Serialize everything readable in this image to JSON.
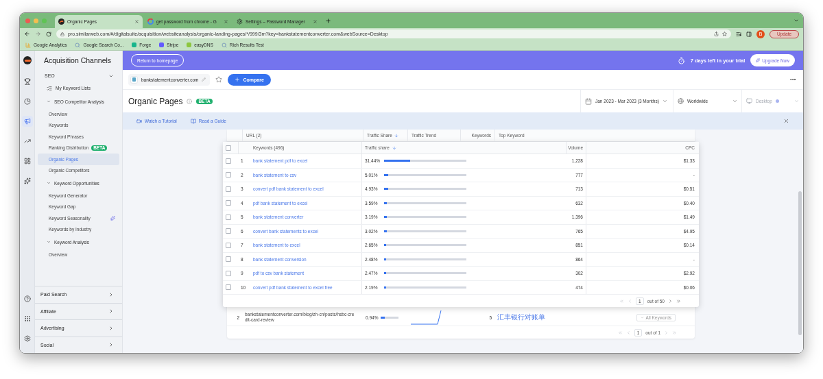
{
  "browser": {
    "tabs": [
      {
        "title": "Organic Pages",
        "selected": true,
        "kind": "site"
      },
      {
        "title": "get password from chrome - G",
        "selected": false,
        "kind": "google"
      },
      {
        "title": "Settings – Password Manager",
        "selected": false,
        "kind": "gear"
      }
    ],
    "url": "pro.similarweb.com/#/digitalsuite/acquisition/websiteanalysis/organic-landing-pages/*/999/3m?key=bankstatementconverter.com&webSource=Desktop",
    "profile": "B",
    "update_button": "Update",
    "bookmarks": [
      {
        "label": "Google Analytics",
        "kind": "analytics"
      },
      {
        "label": "Google Search Co...",
        "kind": "search"
      },
      {
        "label": "Forge",
        "kind": "forge"
      },
      {
        "label": "Stripe",
        "kind": "stripe"
      },
      {
        "label": "easyDNS",
        "kind": "easydns"
      },
      {
        "label": "Rich Results Test",
        "kind": "search"
      }
    ]
  },
  "rail": [
    {
      "kind": "trophy",
      "selected": false
    },
    {
      "kind": "pie",
      "selected": false
    },
    {
      "kind": "megaphone",
      "selected": true
    },
    {
      "kind": "trend",
      "selected": false
    },
    {
      "kind": "dashboard",
      "selected": false
    },
    {
      "kind": "sparkle",
      "selected": false
    }
  ],
  "rail_bottom": [
    {
      "kind": "help"
    },
    {
      "kind": "apps"
    },
    {
      "kind": "settings"
    }
  ],
  "sidebar": {
    "title": "Acquisition Channels",
    "section": {
      "label": "SEO",
      "expanded": true
    },
    "items": [
      {
        "label": "My Keyword Lists",
        "kind": "link"
      },
      {
        "label": "SEO Competitor Analysis",
        "kind": "group",
        "expanded": true,
        "children": [
          {
            "label": "Overview",
            "selected": false
          },
          {
            "label": "Keywords",
            "selected": false
          },
          {
            "label": "Keyword Phrases",
            "selected": false
          },
          {
            "label": "Ranking Distribution",
            "selected": false,
            "badge": "BETA"
          },
          {
            "label": "Organic Pages",
            "selected": true
          },
          {
            "label": "Organic Competitors",
            "selected": false
          }
        ]
      },
      {
        "label": "Keyword Opportunities",
        "kind": "group",
        "expanded": true,
        "children": [
          {
            "label": "Keyword Generator",
            "selected": false
          },
          {
            "label": "Keyword Gap",
            "selected": false
          },
          {
            "label": "Keyword Seasonality",
            "selected": false,
            "new": true
          },
          {
            "label": "Keywords by Industry",
            "selected": false
          }
        ]
      },
      {
        "label": "Keyword Analysis",
        "kind": "group",
        "expanded": true,
        "children": [
          {
            "label": "Overview",
            "selected": false
          }
        ]
      }
    ],
    "footer_sections": [
      "Paid Search",
      "Affiliate",
      "Advertising",
      "Social"
    ]
  },
  "banner": {
    "back_button": "Return to homepage",
    "trial": "7 days left in your trial",
    "upgrade_button": "Upgrade Now"
  },
  "header": {
    "domain": "bankstatementconverter.com",
    "compare_button": "Compare"
  },
  "page": {
    "title": "Organic Pages",
    "badge": "BETA",
    "date_range": "Jan 2023 - Mar 2023 (3 Months)",
    "country": "Worldwide",
    "device": {
      "label": "Desktop",
      "disabled": true
    }
  },
  "help_bar": {
    "links": [
      {
        "label": "Watch a Tutorial",
        "kind": "video"
      },
      {
        "label": "Read a Guide",
        "kind": "guide"
      }
    ]
  },
  "url_table": {
    "columns": [
      {
        "label": "URL (2)",
        "sorted": false
      },
      {
        "label": "Traffic Share",
        "sorted": true
      },
      {
        "label": "Traffic Trend",
        "sorted": false
      },
      {
        "label": "Keywords",
        "sorted": false
      },
      {
        "label": "Top Keyword",
        "sorted": false
      }
    ],
    "rows": [
      {
        "index": "2",
        "url": "bankstatementconverter.com/blog/zh-cn/posts/hsbc-credit-card-review",
        "share": "0.94%",
        "level": 0.2,
        "keywords": "5",
        "top_keyword": "汇丰银行对账单",
        "button": "All Keywords"
      }
    ],
    "pagination": {
      "page": "1",
      "total": "out of 1"
    }
  },
  "keyword_popup": {
    "header_checked": false,
    "columns": [
      {
        "label": "Keywords (496)",
        "sorted": false
      },
      {
        "label": "Traffic share",
        "sorted": true
      },
      {
        "label": "Volume",
        "sorted": false
      },
      {
        "label": "CPC",
        "sorted": false
      }
    ],
    "rows": [
      {
        "index": "1",
        "keyword": "bank statement pdf to excel",
        "share": "31.44%",
        "level": 0.3144,
        "volume": "1,228",
        "cpc": "$1.33",
        "checked": false
      },
      {
        "index": "2",
        "keyword": "bank statement to csv",
        "share": "5.01%",
        "level": 0.0501,
        "volume": "777",
        "cpc": "-",
        "checked": false
      },
      {
        "index": "3",
        "keyword": "convert pdf bank statement to excel",
        "share": "4.93%",
        "level": 0.0493,
        "volume": "713",
        "cpc": "$0.51",
        "checked": false
      },
      {
        "index": "4",
        "keyword": "pdf bank statement to excel",
        "share": "3.59%",
        "level": 0.0359,
        "volume": "632",
        "cpc": "$0.40",
        "checked": false
      },
      {
        "index": "5",
        "keyword": "bank statement converter",
        "share": "3.19%",
        "level": 0.0319,
        "volume": "1,396",
        "cpc": "$1.49",
        "checked": false
      },
      {
        "index": "6",
        "keyword": "convert bank statements to excel",
        "share": "3.02%",
        "level": 0.0302,
        "volume": "765",
        "cpc": "$4.95",
        "checked": false
      },
      {
        "index": "7",
        "keyword": "bank statement to excel",
        "share": "2.65%",
        "level": 0.0265,
        "volume": "851",
        "cpc": "$0.14",
        "checked": false
      },
      {
        "index": "8",
        "keyword": "bank statement conversion",
        "share": "2.48%",
        "level": 0.0248,
        "volume": "864",
        "cpc": "-",
        "checked": false
      },
      {
        "index": "9",
        "keyword": "pdf to csv bank statement",
        "share": "2.47%",
        "level": 0.0247,
        "volume": "302",
        "cpc": "$2.92",
        "checked": false
      },
      {
        "index": "10",
        "keyword": "convert pdf bank statement to excel free",
        "share": "2.19%",
        "level": 0.0219,
        "volume": "474",
        "cpc": "$0.06",
        "checked": false
      }
    ],
    "pagination": {
      "page": "1",
      "total": "out of 50"
    }
  }
}
